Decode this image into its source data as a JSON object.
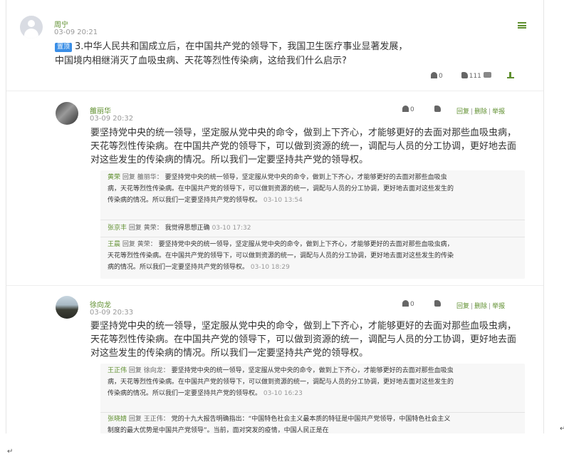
{
  "post": {
    "author": "周宁",
    "time": "03-09 20:21",
    "pin_label": "置顶",
    "title_line1": "3.中华人民共和国成立后，在中国共产党的领导下，我国卫生医疗事业显著发展，",
    "title_line2": "中国境内相继消灭了血吸虫病、天花等烈性传染病，这给我们什么启示?",
    "flower_count": "0",
    "like_count": "111",
    "chat_count": ""
  },
  "comments": [
    {
      "author": "雒丽华",
      "time": "03-09 20:32",
      "flower_count": "0",
      "text": "要坚持党中央的统一领导，坚定服从党中央的命令，做到上下齐心，才能够更好的去面对那些血吸虫病，天花等烈性传染病。在中国共产党的领导下，可以做到资源的统一，调配与人员的分工协调，更好地去面对这些发生的传染病的情况。所以我们一定要坚持共产党的领导权。",
      "links": {
        "reply": "回复",
        "delete": "删除",
        "report": "举报"
      },
      "replies": [
        {
          "name": "黄荣",
          "verb": "回复",
          "target": "雒丽华：",
          "text": "要坚持党中央的统一领导，坚定服从党中央的命令，做到上下齐心，才能够更好的去面对那些血吸虫病，天花等烈性传染病。在中国共产党的领导下，可以做到资源的统一，调配与人员的分工协调，更好地去面对这些发生的传染病的情况。所以我们一定要坚持共产党的领导权。",
          "time": "03-10 13:54"
        },
        {
          "name": "张京丰",
          "verb": "回复",
          "target": "黄荣：",
          "text": "我觉得思想正确",
          "time": "03-10 17:32"
        },
        {
          "name": "王晨",
          "verb": "回复",
          "target": "黄荣：",
          "text": "要坚持党中央的统一领导，坚定服从党中央的命令，做到上下齐心，才能够更好的去面对那些血吸虫病，天花等烈性传染病。在中国共产党的领导下，可以做到资源的统一，调配与人员的分工协调，更好地去面对这些发生的传染病的情况。所以我们一定要坚持共产党的领导权。",
          "time": "03-10 18:29"
        }
      ]
    },
    {
      "author": "徐向龙",
      "time": "03-09 20:33",
      "flower_count": "0",
      "text": "要坚持党中央的统一领导，坚定服从党中央的命令，做到上下齐心，才能够更好的去面对那些血吸虫病，天花等烈性传染病。在中国共产党的领导下，可以做到资源的统一，调配与人员的分工协调，更好地去面对这些发生的传染病的情况。所以我们一定要坚持共产党的领导权。",
      "links": {
        "reply": "回复",
        "delete": "删除",
        "report": "举报"
      },
      "replies": [
        {
          "name": "王正伟",
          "verb": "回复",
          "target": "徐向龙：",
          "text": "要坚持党中央的统一领导，坚定服从党中央的命令，做到上下齐心，才能够更好的去面对那些血吸虫病，天花等烈性传染病。在中国共产党的领导下，可以做到资源的统一，调配与人员的分工协调，更好地去面对这些发生的传染病的情况。所以我们一定要坚持共产党的领导权。",
          "time": "03-10 16:23"
        },
        {
          "name": "张晓婧",
          "verb": "回复",
          "target": "王正伟：",
          "text": "党的十九大报告明确指出：“中国特色社会主义最本质的特征是中国共产党领导，中国特色社会主义制度的最大优势是中国共产党领导”。当前，面对突发的疫情，中国人民正是在",
          "time": ""
        }
      ]
    }
  ],
  "marks": {
    "return1": "↵",
    "return2": "↵"
  },
  "colors": {
    "accent": "#5f8f2f",
    "pin": "#3a8ee6",
    "reply_bg": "#f7f7f7"
  }
}
